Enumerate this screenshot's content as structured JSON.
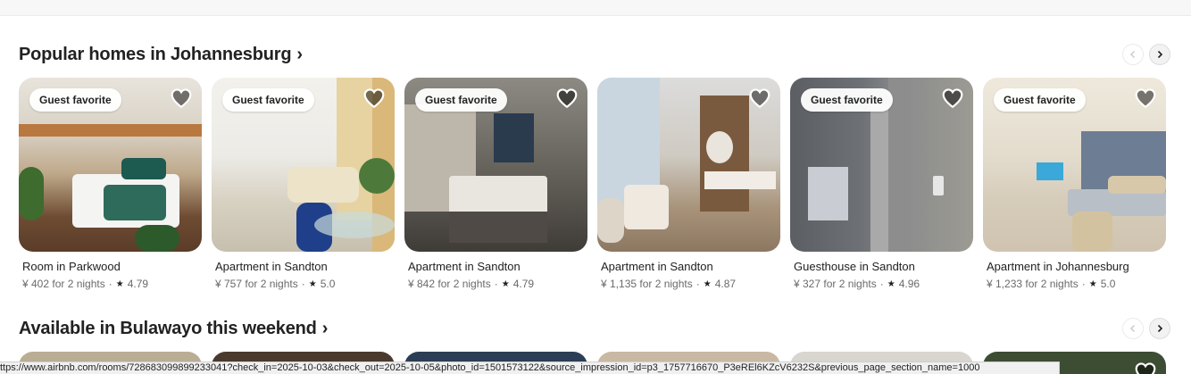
{
  "section1": {
    "title": "Popular homes in Johannesburg",
    "chevron": "›",
    "prev_icon": "chevron-left-icon",
    "next_icon": "chevron-right-icon",
    "listings": [
      {
        "badge": "Guest favorite",
        "title": "Room in Parkwood",
        "price": "¥ 402 for 2 nights",
        "rating": "4.79"
      },
      {
        "badge": "Guest favorite",
        "title": "Apartment in Sandton",
        "price": "¥ 757 for 2 nights",
        "rating": "5.0"
      },
      {
        "badge": "Guest favorite",
        "title": "Apartment in Sandton",
        "price": "¥ 842 for 2 nights",
        "rating": "4.79"
      },
      {
        "badge": "",
        "title": "Apartment in Sandton",
        "price": "¥ 1,135 for 2 nights",
        "rating": "4.87"
      },
      {
        "badge": "Guest favorite",
        "title": "Guesthouse in Sandton",
        "price": "¥ 327 for 2 nights",
        "rating": "4.96"
      },
      {
        "badge": "Guest favorite",
        "title": "Apartment in Johannesburg",
        "price": "¥ 1,233 for 2 nights",
        "rating": "5.0"
      }
    ]
  },
  "section2": {
    "title": "Available in Bulawayo this weekend",
    "chevron": "›"
  },
  "meta_separator": "·",
  "star_glyph": "★",
  "status_url": "ttps://www.airbnb.com/rooms/728683099899233041?check_in=2025-10-03&check_out=2025-10-05&photo_id=1501573122&source_impression_id=p3_1757716670_P3eREl6KZcV6232S&previous_page_section_name=1000",
  "colors": {
    "text": "#222222",
    "muted": "#6a6a6a",
    "heart_fill": "rgba(0,0,0,0.5)"
  }
}
